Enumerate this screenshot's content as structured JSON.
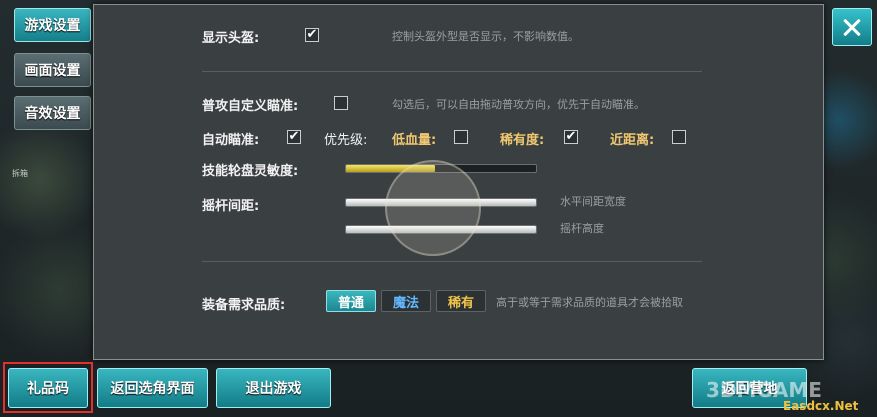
{
  "sidebar": {
    "tabs": [
      {
        "label": "游戏设置"
      },
      {
        "label": "画面设置"
      },
      {
        "label": "音效设置"
      }
    ]
  },
  "background": {
    "side_text": "拆箱"
  },
  "settings": {
    "show_helmet": {
      "label": "显示头盔:",
      "checked": true,
      "hint": "控制头盔外型是否显示，不影响数值。"
    },
    "custom_aim": {
      "label": "普攻自定义瞄准:",
      "checked": false,
      "hint": "勾选后，可以自由拖动普攻方向，优先于自动瞄准。"
    },
    "auto_aim": {
      "label": "自动瞄准:",
      "checked": true
    },
    "priority": {
      "label": "优先级:",
      "options": [
        {
          "label": "低血量:",
          "checked": false
        },
        {
          "label": "稀有度:",
          "checked": true
        },
        {
          "label": "近距离:",
          "checked": false
        }
      ]
    },
    "wheel_sensitivity": {
      "label": "技能轮盘灵敏度:",
      "value": 0.47
    },
    "joystick_spacing": {
      "label": "摇杆间距:",
      "horizontal": {
        "hint": "水平间距宽度",
        "value": 1.0
      },
      "height": {
        "hint": "摇杆高度",
        "value": 1.0
      }
    },
    "equipment_quality": {
      "label": "装备需求品质:",
      "options": [
        {
          "label": "普通",
          "selected": true
        },
        {
          "label": "魔法",
          "selected": false
        },
        {
          "label": "稀有",
          "selected": false
        }
      ],
      "hint": "高于或等于需求品质的道具才会被拾取"
    }
  },
  "bottom_bar": {
    "gift_code": "礼品码",
    "back_to_select": "返回选角界面",
    "exit_game": "退出游戏",
    "return_camp": "返回营地"
  },
  "watermark": {
    "line1": "3DMGAME",
    "line2": "Easdcx.Net"
  },
  "colors": {
    "accent": "#1f9aa5",
    "panel": "#3a3f42",
    "gold_text": "#f0c870",
    "magic_text": "#62b9ff",
    "rare_text": "#f2c34a",
    "highlight_border": "#e03030"
  }
}
